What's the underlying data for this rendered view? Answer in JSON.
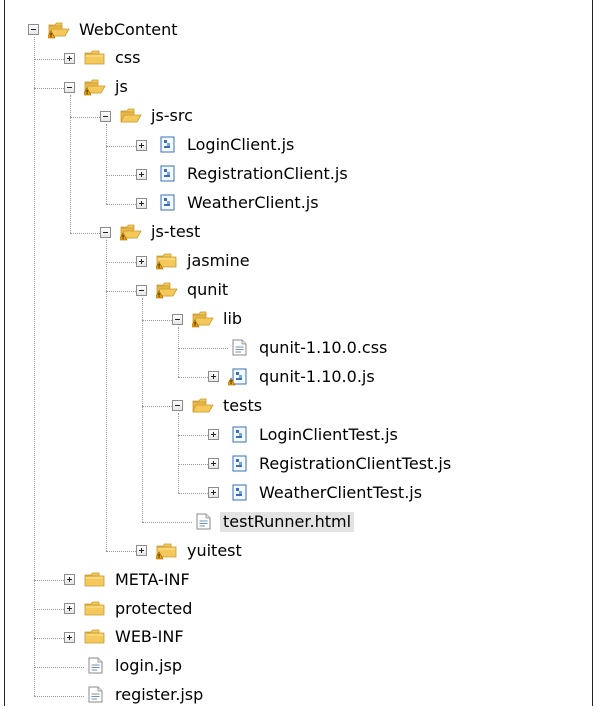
{
  "tree": {
    "items": [
      {
        "label": "WebContent",
        "icon": "folder-open-warning-icon",
        "expander": "expanded"
      },
      {
        "label": "css",
        "icon": "folder-closed-icon",
        "expander": "collapsed"
      },
      {
        "label": "js",
        "icon": "folder-open-warning-icon",
        "expander": "expanded"
      },
      {
        "label": "js-src",
        "icon": "folder-open-icon",
        "expander": "expanded"
      },
      {
        "label": "LoginClient.js",
        "icon": "js-file-icon",
        "expander": "collapsed"
      },
      {
        "label": "RegistrationClient.js",
        "icon": "js-file-icon",
        "expander": "collapsed"
      },
      {
        "label": "WeatherClient.js",
        "icon": "js-file-icon",
        "expander": "collapsed"
      },
      {
        "label": "js-test",
        "icon": "folder-open-warning-icon",
        "expander": "expanded"
      },
      {
        "label": "jasmine",
        "icon": "folder-closed-warning-icon",
        "expander": "collapsed"
      },
      {
        "label": "qunit",
        "icon": "folder-open-warning-icon",
        "expander": "expanded"
      },
      {
        "label": "lib",
        "icon": "folder-open-warning-icon",
        "expander": "expanded"
      },
      {
        "label": "qunit-1.10.0.css",
        "icon": "css-file-icon",
        "expander": "none"
      },
      {
        "label": "qunit-1.10.0.js",
        "icon": "js-file-warning-icon",
        "expander": "collapsed"
      },
      {
        "label": "tests",
        "icon": "folder-open-icon",
        "expander": "expanded"
      },
      {
        "label": "LoginClientTest.js",
        "icon": "js-file-icon",
        "expander": "collapsed"
      },
      {
        "label": "RegistrationClientTest.js",
        "icon": "js-file-icon",
        "expander": "collapsed"
      },
      {
        "label": "WeatherClientTest.js",
        "icon": "js-file-icon",
        "expander": "collapsed"
      },
      {
        "label": "testRunner.html",
        "icon": "html-file-icon",
        "expander": "none",
        "selected": true
      },
      {
        "label": "yuitest",
        "icon": "folder-closed-warning-icon",
        "expander": "collapsed"
      },
      {
        "label": "META-INF",
        "icon": "folder-closed-icon",
        "expander": "collapsed"
      },
      {
        "label": "protected",
        "icon": "folder-closed-icon",
        "expander": "collapsed"
      },
      {
        "label": "WEB-INF",
        "icon": "folder-closed-icon",
        "expander": "collapsed"
      },
      {
        "label": "login.jsp",
        "icon": "jsp-file-icon",
        "expander": "none"
      },
      {
        "label": "register.jsp",
        "icon": "jsp-file-icon",
        "expander": "none"
      }
    ]
  },
  "colors": {
    "folder": "#f4c85a",
    "folder_edge": "#c99a2e",
    "warning": "#f2a100",
    "js_icon": "#3a6fb5",
    "selection": "#e3e3e3"
  }
}
